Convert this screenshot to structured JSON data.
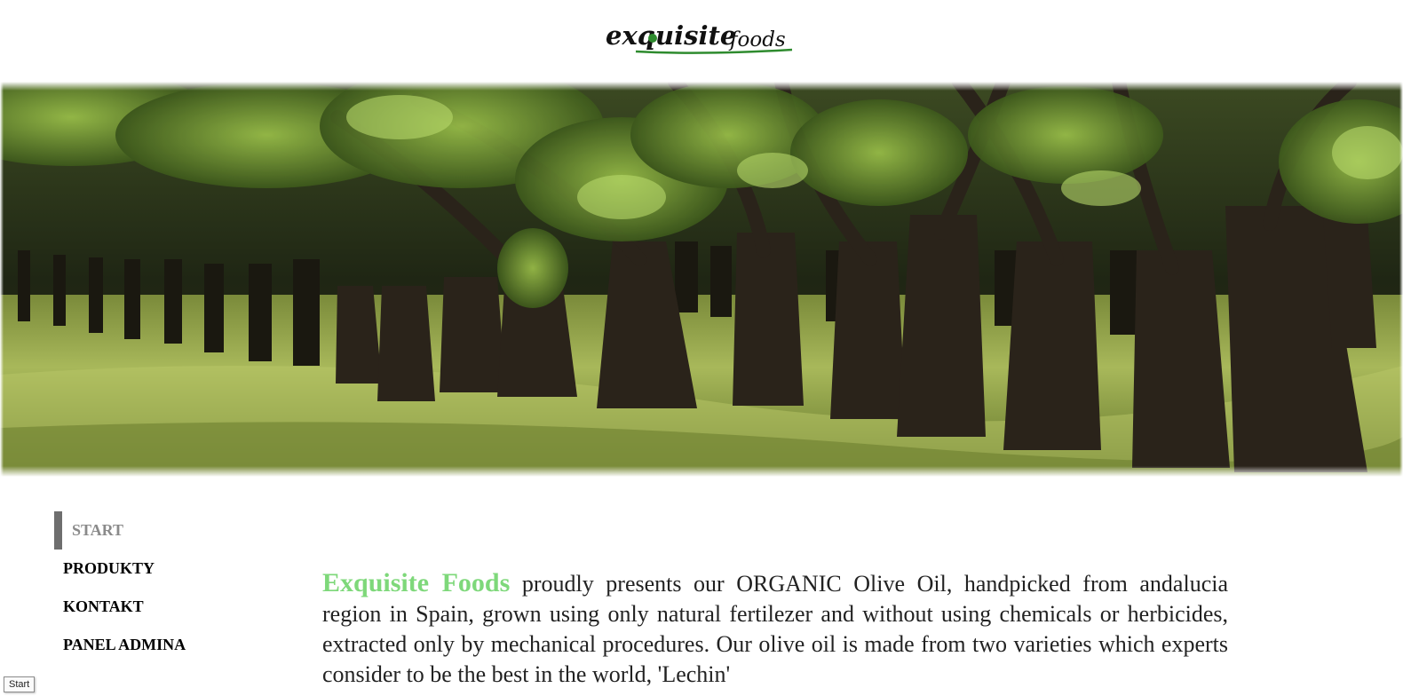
{
  "header": {
    "logo": {
      "main": "exquisite",
      "sub": "foods"
    }
  },
  "hero": {
    "description": "olive orchard photo"
  },
  "nav": {
    "items": [
      {
        "label": "START",
        "active": true
      },
      {
        "label": "PRODUKTY",
        "active": false
      },
      {
        "label": "KONTAKT",
        "active": false
      },
      {
        "label": "PANEL ADMINA",
        "active": false
      }
    ]
  },
  "content": {
    "brand": "Exquisite Foods",
    "paragraph": " proudly presents our ORGANIC Olive Oil, handpicked from andalucia region in Spain, grown using only natural fertilezer and without using chemicals or herbicides, extracted only by mechanical procedures. Our olive oil is made from two varieties which experts consider to be the best in the world, 'Lechin'"
  },
  "tooltip": {
    "text": "Start"
  },
  "colors": {
    "brand_green": "#7ed87a",
    "logo_green": "#2e8b2e",
    "nav_active": "#8a8a8a",
    "nav_marker": "#6e6e6e"
  }
}
